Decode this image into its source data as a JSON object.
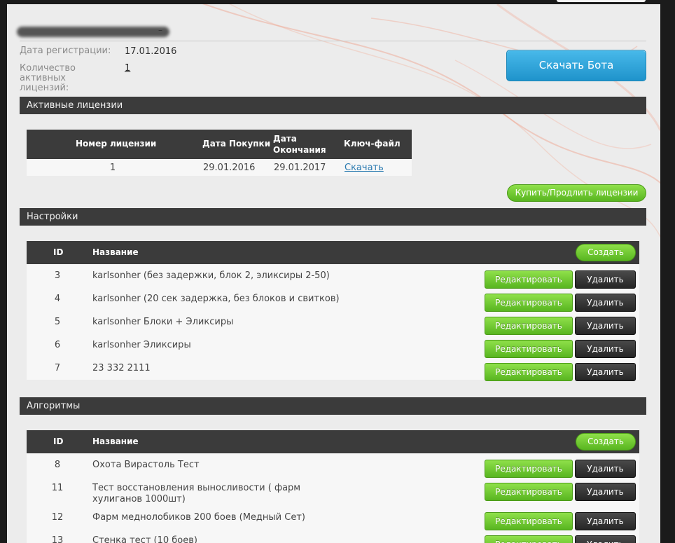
{
  "account": {
    "registration_label": "Дата регистрации:",
    "registration_date": "17.01.2016",
    "active_licenses_label": "Количество активных лицензий:",
    "active_licenses_count": "1",
    "download_bot_button": "Скачать Бота",
    "username_dash": "–"
  },
  "licenses": {
    "section_title": "Активные лицензии",
    "columns": [
      "Номер лицензии",
      "Дата Покупки",
      "Дата Окончания",
      "Ключ-файл"
    ],
    "rows": [
      {
        "number": "1",
        "purchase_date": "29.01.2016",
        "end_date": "29.01.2017",
        "keyfile_link": "Скачать"
      }
    ],
    "buy_button": "Купить/Продлить лицензии"
  },
  "settings": {
    "section_title": "Настройки",
    "columns": {
      "id": "ID",
      "name": "Название"
    },
    "create_button": "Создать",
    "edit_label": "Редактировать",
    "delete_label": "Удалить",
    "rows": [
      {
        "id": "3",
        "name": "karlsonher (без задержки, блок 2, эликсиры 2-50)"
      },
      {
        "id": "4",
        "name": "karlsonher (20 сек задержка, без блоков и свитков)"
      },
      {
        "id": "5",
        "name": "karlsonher Блоки + Эликсиры"
      },
      {
        "id": "6",
        "name": "karlsonher Эликсиры"
      },
      {
        "id": "7",
        "name": "23 332 2111"
      }
    ]
  },
  "algorithms": {
    "section_title": "Алгоритмы",
    "columns": {
      "id": "ID",
      "name": "Название"
    },
    "create_button": "Создать",
    "edit_label": "Редактировать",
    "delete_label": "Удалить",
    "rows": [
      {
        "id": "8",
        "name": "Охота Вирастоль Тест"
      },
      {
        "id": "11",
        "name": "Тест восстановления выносливости ( фарм хулиганов 1000шт)"
      },
      {
        "id": "12",
        "name": "Фарм меднолобиков 200 боев (Медный Сет)"
      },
      {
        "id": "13",
        "name": "Стенка тест (10 боев)"
      }
    ]
  },
  "colors": {
    "panel_bg": "#ececec",
    "header_bg": "#3b3b3b",
    "accent_blue": "#1f93cb",
    "accent_green": "#58b520",
    "dark_button": "#262626"
  }
}
